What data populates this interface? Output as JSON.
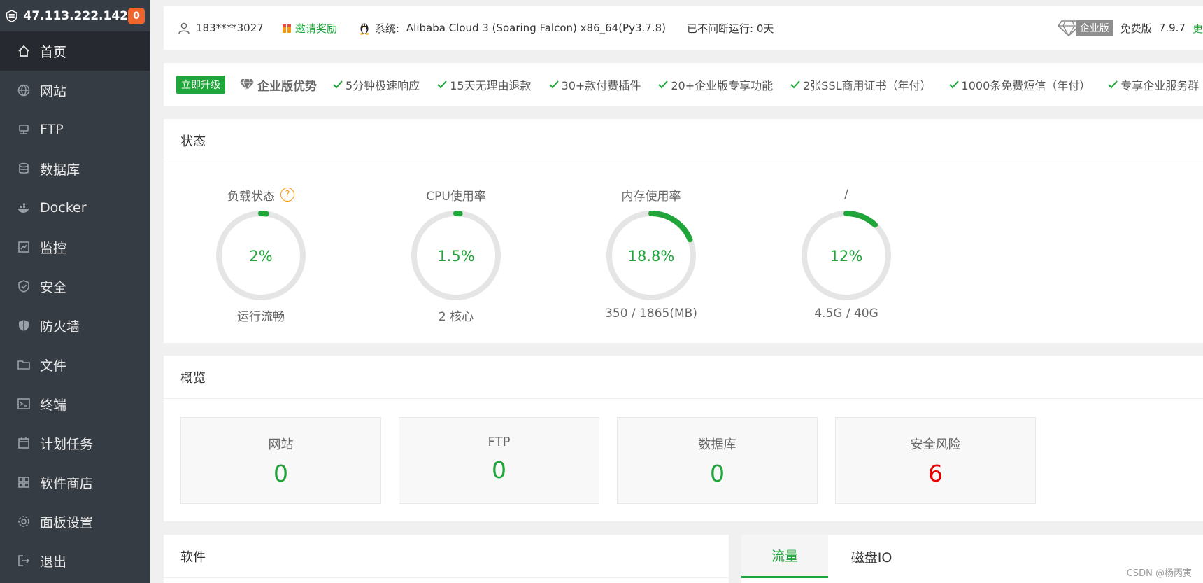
{
  "sidebar": {
    "ip": "47.113.222.142",
    "badge": "0",
    "items": [
      {
        "label": "首页"
      },
      {
        "label": "网站"
      },
      {
        "label": "FTP"
      },
      {
        "label": "数据库"
      },
      {
        "label": "Docker"
      },
      {
        "label": "监控"
      },
      {
        "label": "安全"
      },
      {
        "label": "防火墙"
      },
      {
        "label": "文件"
      },
      {
        "label": "终端"
      },
      {
        "label": "计划任务"
      },
      {
        "label": "软件商店"
      },
      {
        "label": "面板设置"
      },
      {
        "label": "退出"
      }
    ]
  },
  "topbar": {
    "user": "183****3027",
    "invite": "邀请奖励",
    "system_label": "系统:",
    "system_value": "Alibaba Cloud 3 (Soaring Falcon) x86_64(Py3.7.8)",
    "uptime": "已不间断运行: 0天",
    "enterprise_label": "企业版",
    "free_label": "免费版",
    "version": "7.9.7",
    "update": "更"
  },
  "promo": {
    "button": "立即升级",
    "title": "企业版优势",
    "features": [
      "5分钟极速响应",
      "15天无理由退款",
      "30+款付费插件",
      "20+企业版专享功能",
      "2张SSL商用证书（年付）",
      "1000条免费短信（年付）",
      "专享企业服务群"
    ]
  },
  "status": {
    "title": "状态",
    "gauges": [
      {
        "title": "负载状态",
        "value": "2%",
        "percent": 2,
        "sub": "运行流畅",
        "help": "?"
      },
      {
        "title": "CPU使用率",
        "value": "1.5%",
        "percent": 1.5,
        "sub": "2 核心"
      },
      {
        "title": "内存使用率",
        "value": "18.8%",
        "percent": 18.8,
        "sub": "350 / 1865(MB)"
      },
      {
        "title": "/",
        "value": "12%",
        "percent": 12,
        "sub": "4.5G / 40G"
      }
    ]
  },
  "overview": {
    "title": "概览",
    "cards": [
      {
        "label": "网站",
        "value": "0"
      },
      {
        "label": "FTP",
        "value": "0"
      },
      {
        "label": "数据库",
        "value": "0"
      },
      {
        "label": "安全风险",
        "value": "6"
      }
    ]
  },
  "software": {
    "title": "软件"
  },
  "traffic": {
    "tabs": [
      "流量",
      "磁盘IO"
    ]
  },
  "watermark": "CSDN @杨丙寅",
  "colors": {
    "accent": "#20a53a",
    "danger": "#e60000",
    "sidebar": "#363c44",
    "sidebar_active": "#262a30",
    "badge": "#f0642d"
  }
}
